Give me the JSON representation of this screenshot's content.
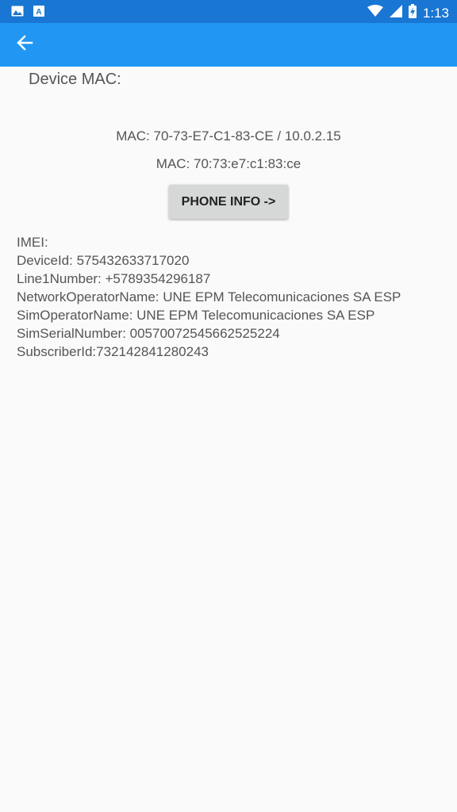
{
  "status_bar": {
    "time": "1:13",
    "icons": [
      "image-icon",
      "font-download-icon",
      "wifi-icon",
      "signal-icon",
      "battery-charging-icon"
    ],
    "color": "#1976d2"
  },
  "app_bar": {
    "color": "#2196f3",
    "back_icon": "arrow-back-icon"
  },
  "main": {
    "device_mac_label": "Device MAC:",
    "mac_line_1": "MAC: 70-73-E7-C1-83-CE / 10.0.2.15",
    "mac_line_2": "MAC: 70:73:e7:c1:83:ce",
    "phone_info_button": "PHONE INFO ->",
    "info_lines": [
      "IMEI:",
      "DeviceId: 575432633717020",
      "Line1Number: +5789354296187",
      "NetworkOperatorName: UNE EPM Telecomunicaciones SA ESP",
      "SimOperatorName: UNE EPM Telecomunicaciones SA ESP",
      "SimSerialNumber: 0057007254566252 5224",
      "SubscriberId:732142841280243"
    ]
  }
}
